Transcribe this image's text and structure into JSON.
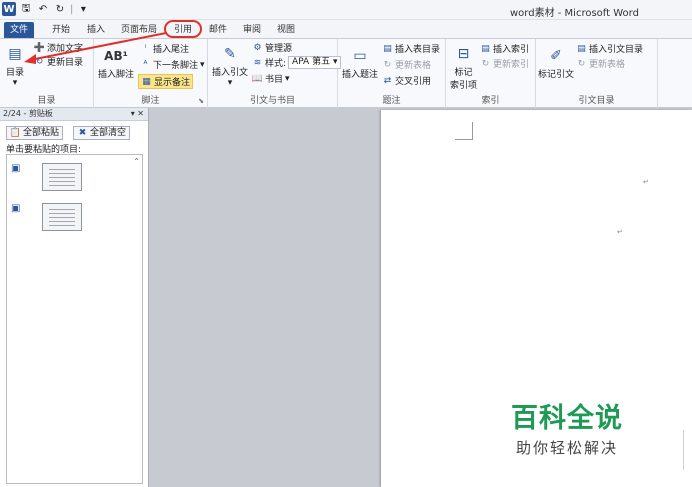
{
  "window": {
    "title": "word素材 - Microsoft Word"
  },
  "qat": {
    "logo": "W",
    "save": "🖫",
    "undo": "↶",
    "redo": "↻",
    "more": "▾"
  },
  "tabs": [
    {
      "label": "文件"
    },
    {
      "label": "开始"
    },
    {
      "label": "插入"
    },
    {
      "label": "页面布局"
    },
    {
      "label": "引用"
    },
    {
      "label": "邮件"
    },
    {
      "label": "审阅"
    },
    {
      "label": "视图"
    }
  ],
  "ribbon": {
    "toc": {
      "label": "目录",
      "add_text": "添加文字",
      "update_toc": "更新目录",
      "toc_btn": "目录"
    },
    "footnotes": {
      "label": "脚注",
      "insert_footnote": "插入脚注",
      "insert_endnote": "插入尾注",
      "next_footnote": "下一条脚注",
      "show_notes": "显示备注"
    },
    "citations": {
      "label": "引文与书目",
      "insert_citation": "插入引文",
      "manage_sources": "管理源",
      "style_label": "样式:",
      "style_value": "APA 第五",
      "bibliography": "书目"
    },
    "captions": {
      "label": "题注",
      "insert_caption": "插入题注",
      "insert_table_of_figures": "插入表目录",
      "update_table": "更新表格",
      "cross_reference": "交叉引用"
    },
    "index": {
      "label": "索引",
      "mark_entry_line1": "标记",
      "mark_entry_line2": "索引项",
      "insert_index": "插入索引",
      "update_index": "更新索引"
    },
    "toa": {
      "label": "引文目录",
      "mark_citation": "标记引文",
      "insert_toa": "插入引文目录",
      "update_table": "更新表格"
    }
  },
  "clipboard": {
    "header": "2/24 - 剪贴板",
    "paste_all": "全部粘贴",
    "clear_all": "全部清空",
    "hint": "单击要粘贴的项目:"
  },
  "watermark": {
    "main": "百科全说",
    "sub": "助你轻松解决"
  },
  "colors": {
    "accent": "#2b579a",
    "annotation": "#e0302a",
    "watermark": "#1e9a55"
  }
}
